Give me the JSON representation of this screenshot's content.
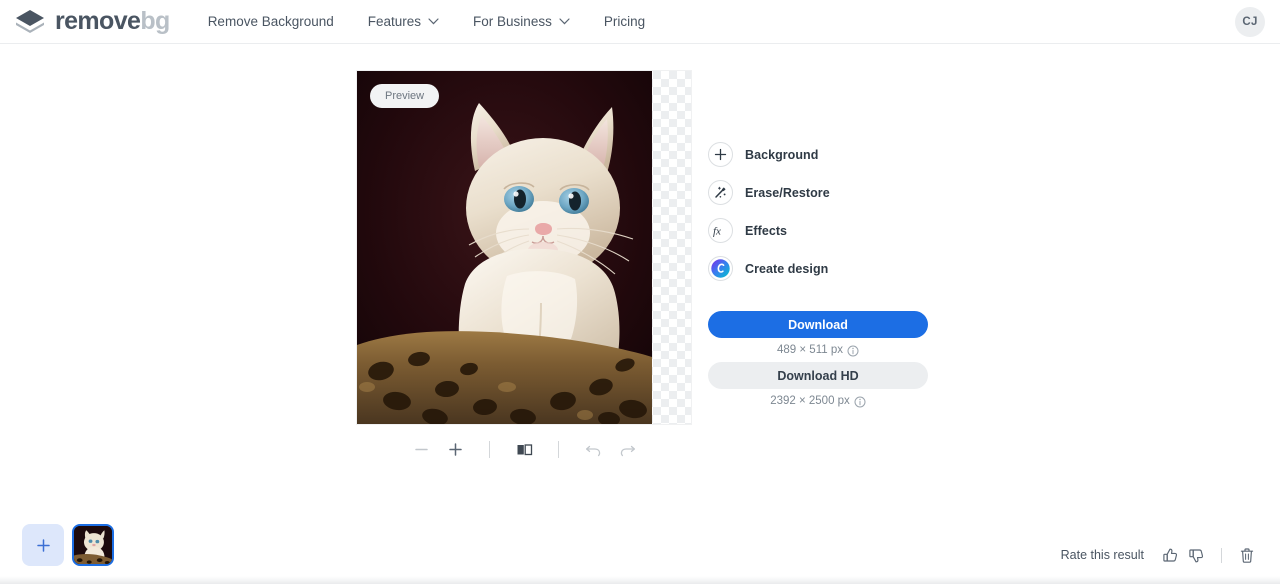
{
  "nav": {
    "logo": {
      "name_a": "remove",
      "name_b": "bg",
      "icon": "layers-diamond-icon"
    },
    "items": [
      {
        "label": "Remove Background",
        "has_chevron": false
      },
      {
        "label": "Features",
        "has_chevron": true
      },
      {
        "label": "For Business",
        "has_chevron": true
      },
      {
        "label": "Pricing",
        "has_chevron": false
      }
    ],
    "avatar_initials": "CJ"
  },
  "canvas": {
    "preview_badge": "Preview",
    "image_alt": "cream kitten with blue eyes on leopard print blanket",
    "transparent_area": "checkerboard"
  },
  "toolbar": {
    "zoom_out": "−",
    "zoom_in": "+",
    "compare_icon": "split-compare-icon",
    "undo_icon": "undo-icon",
    "redo_icon": "redo-icon"
  },
  "tools": [
    {
      "label": "Background",
      "icon": "plus-icon"
    },
    {
      "label": "Erase/Restore",
      "icon": "magic-wand-icon"
    },
    {
      "label": "Effects",
      "icon": "fx-icon"
    },
    {
      "label": "Create design",
      "icon": "canva-logo-icon"
    }
  ],
  "download": {
    "primary_label": "Download",
    "primary_size": "489 × 511 px",
    "hd_label": "Download HD",
    "hd_size": "2392 × 2500 px",
    "info_icon": "info-circle-icon"
  },
  "bottom": {
    "add_label": "+",
    "rate_label": "Rate this result",
    "thumbs_up_icon": "thumbs-up-icon",
    "thumbs_down_icon": "thumbs-down-icon",
    "delete_icon": "trash-icon"
  },
  "colors": {
    "accent_blue": "#1c6ee4",
    "nav_text": "#4a5562",
    "logo_gray": "#b9c0c7",
    "button_gray": "#eceef0"
  }
}
